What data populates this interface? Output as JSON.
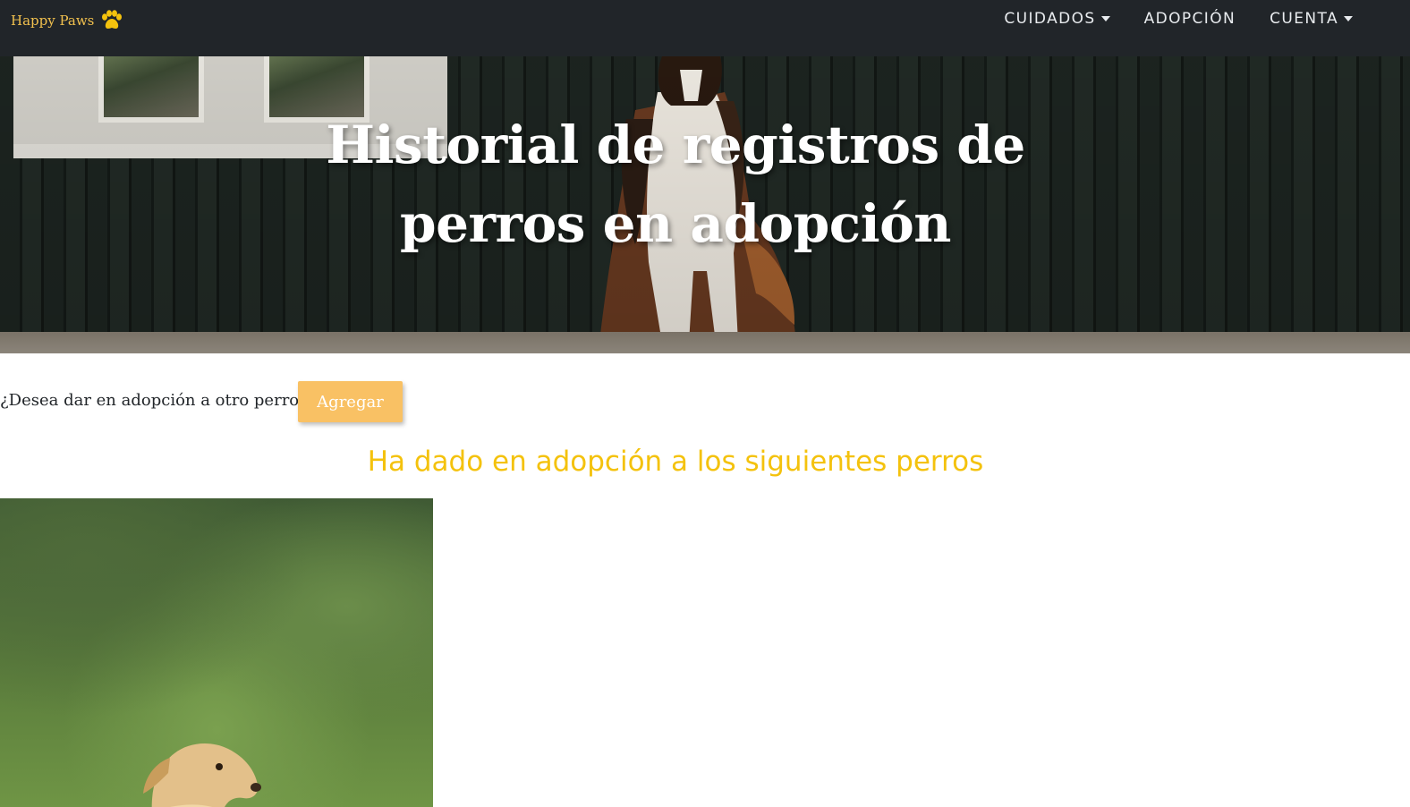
{
  "navbar": {
    "brand": "Happy Paws",
    "brand_icon": "paw-icon",
    "links": [
      {
        "label": "CUIDADOS",
        "dropdown": true
      },
      {
        "label": "ADOPCIÓN",
        "dropdown": false
      },
      {
        "label": "CUENTA",
        "dropdown": true
      }
    ]
  },
  "hero": {
    "title_line1": "Historial de registros de",
    "title_line2": "perros en adopción"
  },
  "cta": {
    "question": "¿Desea dar en adopción a otro perro?",
    "button_label": "Agregar"
  },
  "section": {
    "heading": "Ha dado en adopción a los siguientes perros"
  },
  "colors": {
    "navbar_bg": "#212529",
    "brand": "#f2c14e",
    "button": "#f9c164",
    "heading": "#f4c20d"
  }
}
